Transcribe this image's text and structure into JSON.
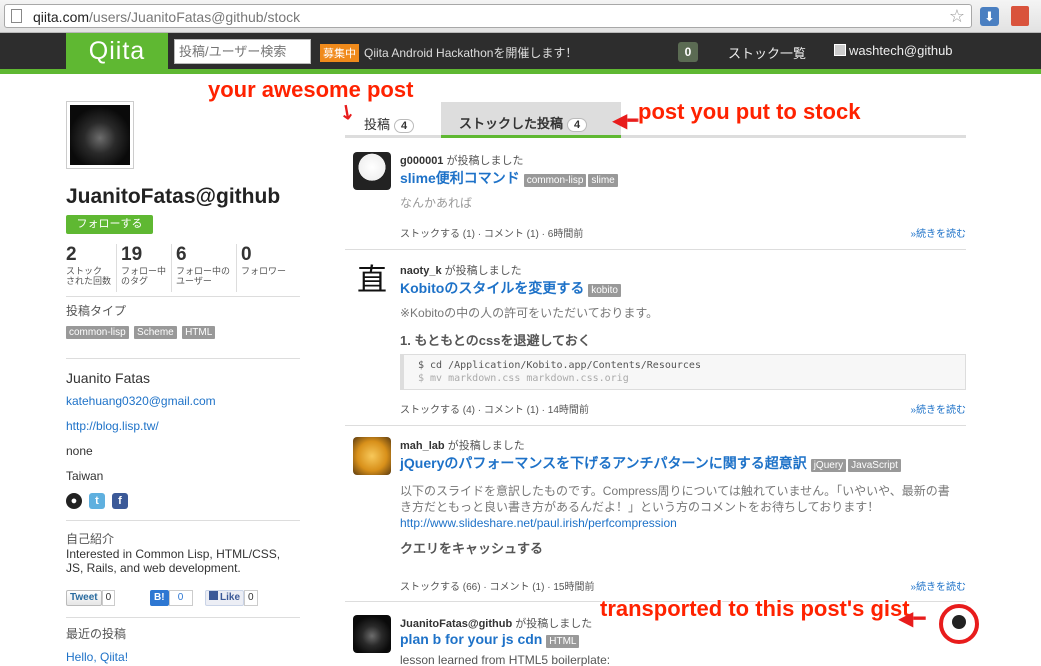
{
  "browser": {
    "url_domain": "qiita.com",
    "url_path": "/users/JuanitoFatas@github/stock"
  },
  "header": {
    "logo": "Qiita",
    "search_placeholder": "投稿/ユーザー検索",
    "recruit_badge": "募集中",
    "notice": "Qiita Android Hackathonを開催します！",
    "notification_count": "0",
    "stock_list": "ストック一覧",
    "user": "washtech@github"
  },
  "profile": {
    "name": "JuanitoFatas@github",
    "follow_button": "フォローする",
    "stats": [
      {
        "num": "2",
        "label1": "ストック",
        "label2": "された回数"
      },
      {
        "num": "19",
        "label1": "フォロー中",
        "label2": "のタグ"
      },
      {
        "num": "6",
        "label1": "フォロー中の",
        "label2": "ユーザー"
      },
      {
        "num": "0",
        "label1": "フォロワー",
        "label2": ""
      }
    ],
    "post_types_heading": "投稿タイプ",
    "post_types": [
      "common-lisp",
      "Scheme",
      "HTML"
    ],
    "real_name": "Juanito Fatas",
    "email": "katehuang0320@gmail.com",
    "website": "http://blog.lisp.tw/",
    "organization": "none",
    "location": "Taiwan",
    "bio_heading": "自己紹介",
    "bio": "Interested in Common Lisp, HTML/CSS, JS, Rails, and web development.",
    "share": {
      "tweet": "Tweet",
      "tweet_count": "0",
      "hatena": "B!",
      "hatena_count": "0",
      "like": "Like",
      "like_count": "0"
    },
    "recent_heading": "最近の投稿",
    "recent_post": "Hello, Qiita!"
  },
  "tabs": {
    "posts_label": "投稿",
    "posts_count": "4",
    "stock_label": "ストックした投稿",
    "stock_count": "4"
  },
  "posts": [
    {
      "author": "g000001",
      "action": "が投稿しました",
      "title": "slime便利コマンド",
      "tags": [
        "common-lisp",
        "slime"
      ],
      "desc": "なんかあれば",
      "stock": "ストックする (1)",
      "comment": "コメント (1)",
      "time": "6時間前",
      "more": "»続きを読む"
    },
    {
      "author": "naoty_k",
      "action": "が投稿しました",
      "title": "Kobitoのスタイルを変更する",
      "tags": [
        "kobito"
      ],
      "desc": "※Kobitoの中の人の許可をいただいております。",
      "heading": "1. もともとのcssを退避しておく",
      "code1": "$ cd /Application/Kobito.app/Contents/Resources",
      "code2": "$ mv markdown.css markdown.css.orig",
      "stock": "ストックする (4)",
      "comment": "コメント (1)",
      "time": "14時間前",
      "more": "»続きを読む"
    },
    {
      "author": "mah_lab",
      "action": "が投稿しました",
      "title": "jQueryのパフォーマンスを下げるアンチパターンに関する超意訳",
      "tags": [
        "jQuery",
        "JavaScript"
      ],
      "desc1": "以下のスライドを意訳したものです。Compress周りについては触れていません。「いやいや、最新の書",
      "desc2": "き方だともっと良い書き方があるんだよ！」という方のコメントをお待ちしております！",
      "link": "http://www.slideshare.net/paul.irish/perfcompression",
      "heading": "クエリをキャッシュする",
      "stock": "ストックする (66)",
      "comment": "コメント (1)",
      "time": "15時間前",
      "more": "»続きを読む"
    },
    {
      "author": "JuanitoFatas@github",
      "action": "が投稿しました",
      "title": "plan b for your js cdn",
      "tags": [
        "HTML"
      ],
      "desc": "lesson learned from HTML5 boilerplate:"
    }
  ],
  "annotations": {
    "a1": "your awesome post",
    "a2": "post you put to stock",
    "a3": "transported to this post's gist"
  },
  "colors": {
    "accent_green": "#5fb832",
    "link_blue": "#1e72c8",
    "annotation_red": "#e81c1c"
  }
}
